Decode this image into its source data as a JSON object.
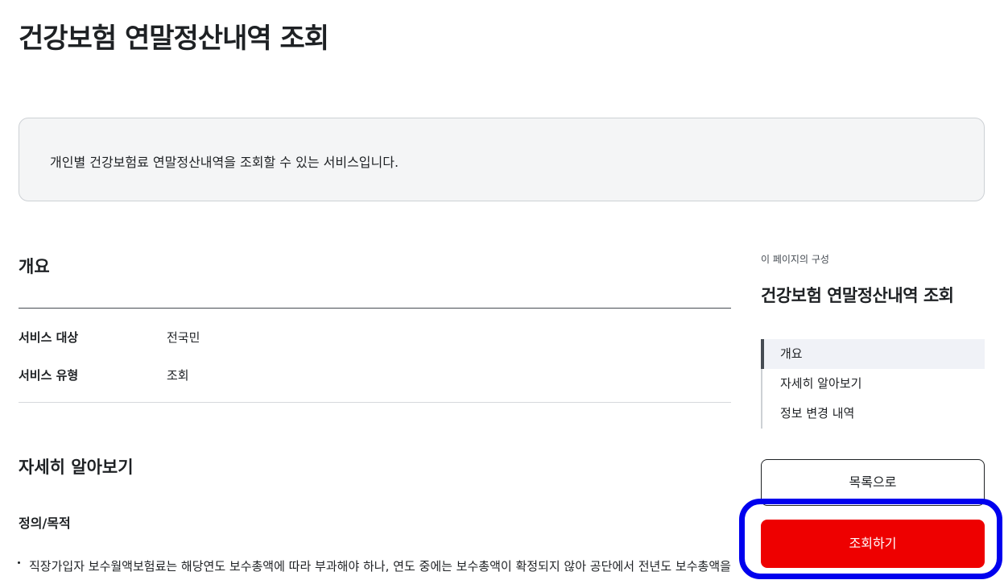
{
  "page": {
    "title": "건강보험 연말정산내역 조회"
  },
  "intro": {
    "text": "개인별 건강보험료 연말정산내역을 조회할 수 있는 서비스입니다."
  },
  "overview": {
    "heading": "개요",
    "rows": [
      {
        "label": "서비스 대상",
        "value": "전국민"
      },
      {
        "label": "서비스 유형",
        "value": "조회"
      }
    ]
  },
  "details": {
    "heading": "자세히 알아보기",
    "subheading": "정의/목적",
    "body": "직장가입자 보수월액보험료는 해당연도 보수총액에 따라 부과해야 하나, 연도 중에는 보수총액이 확정되지 않아 공단에서 전년도 보수총액을 기준으로 우선 부과합니다."
  },
  "toc": {
    "caption": "이 페이지의 구성",
    "title": "건강보험 연말정산내역 조회",
    "items": [
      {
        "label": "개요",
        "active": true
      },
      {
        "label": "자세히 알아보기",
        "active": false
      },
      {
        "label": "정보 변경 내역",
        "active": false
      }
    ]
  },
  "actions": {
    "list_label": "목록으로",
    "query_label": "조회하기"
  },
  "colors": {
    "primary_action": "#ee0000",
    "highlight_ring": "#0000ee",
    "intro_background": "#f4f5f6"
  }
}
